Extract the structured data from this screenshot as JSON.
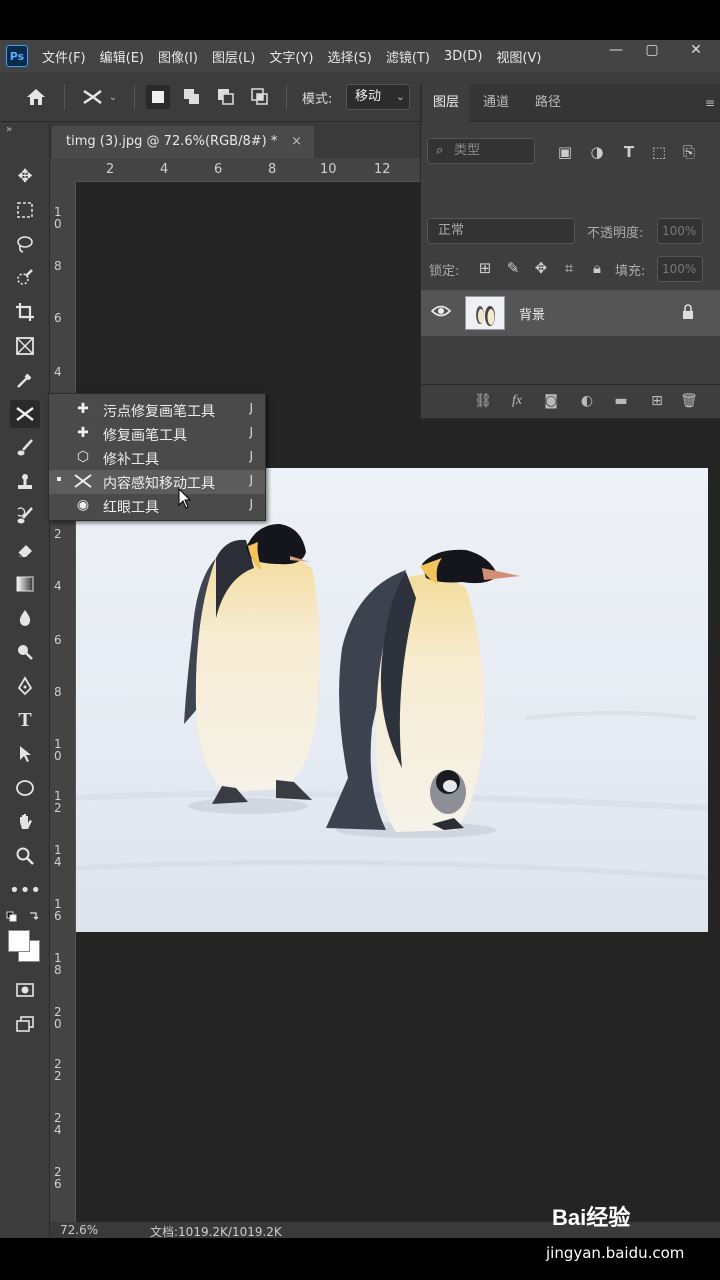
{
  "app": {
    "logo": "Ps"
  },
  "menu": {
    "items": [
      "文件(F)",
      "编辑(E)",
      "图像(I)",
      "图层(L)",
      "文字(Y)",
      "选择(S)",
      "滤镜(T)",
      "3D(D)",
      "视图(V)"
    ]
  },
  "options": {
    "mode_label": "模式:",
    "mode_value": "移动"
  },
  "document": {
    "tab_title": "timg (3).jpg @ 72.6%(RGB/8#) *",
    "close": "×"
  },
  "rulers": {
    "horizontal": [
      "2",
      "4",
      "6",
      "8",
      "10",
      "12"
    ],
    "vertical": [
      "1\n0",
      "8",
      "6",
      "4",
      "2",
      "4",
      "6",
      "8",
      "1\n0",
      "1\n2",
      "1\n4",
      "1\n6",
      "1\n8",
      "2\n0",
      "2\n2",
      "2\n4",
      "2\n6"
    ]
  },
  "flyout": {
    "items": [
      {
        "label": "污点修复画笔工具",
        "key": "J",
        "icon": "spot-healing-brush-icon"
      },
      {
        "label": "修复画笔工具",
        "key": "J",
        "icon": "healing-brush-icon"
      },
      {
        "label": "修补工具",
        "key": "J",
        "icon": "patch-icon"
      },
      {
        "label": "内容感知移动工具",
        "key": "J",
        "icon": "content-aware-move-icon"
      },
      {
        "label": "红眼工具",
        "key": "J",
        "icon": "red-eye-icon"
      }
    ]
  },
  "layers": {
    "tabs": [
      "图层",
      "通道",
      "路径"
    ],
    "filter_placeholder": "类型",
    "blend_mode": "正常",
    "opacity_label": "不透明度:",
    "opacity_value": "100%",
    "lock_label": "锁定:",
    "fill_label": "填充:",
    "fill_value": "100%",
    "layer_name": "背景"
  },
  "status": {
    "zoom": "72.6%",
    "doc": "文档:1019.2K/1019.2K"
  },
  "watermark": {
    "logo": "Bai经验",
    "url": "jingyan.baidu.com"
  }
}
